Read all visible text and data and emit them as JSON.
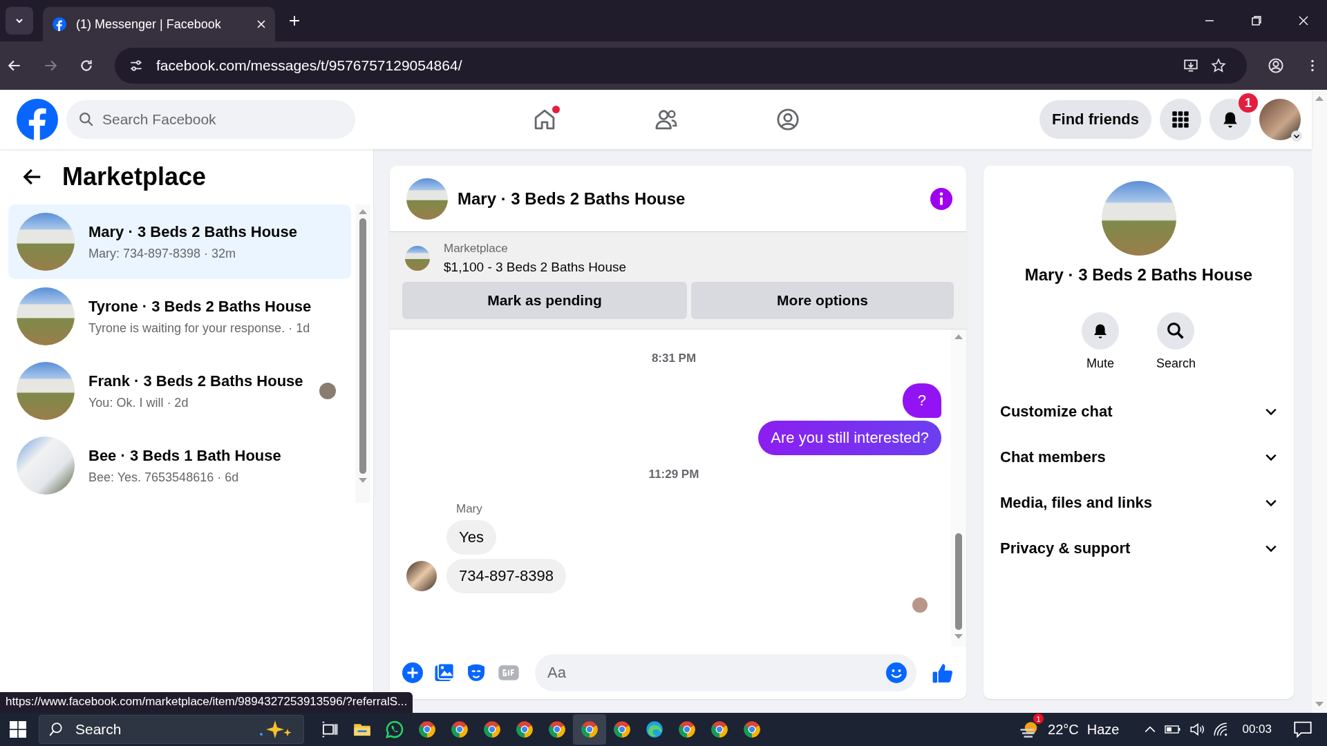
{
  "browser": {
    "tabs": [
      {
        "title": "(1) Messenger | Facebook",
        "selected": true
      }
    ],
    "url": "facebook.com/messages/t/9576757129054864/"
  },
  "fb_header": {
    "search_placeholder": "Search Facebook",
    "nav": [
      {
        "kind": "home",
        "dot": true
      },
      {
        "kind": "friends",
        "dot": false
      },
      {
        "kind": "groups",
        "dot": false
      }
    ],
    "find_friends": "Find friends",
    "notification_count": "1"
  },
  "sidebar": {
    "title": "Marketplace",
    "conversations": [
      {
        "title": "Mary · 3 Beds 2 Baths House",
        "preview": "Mary: 734-897-8398 · 32m",
        "selected": true,
        "seen": false,
        "kind": "house"
      },
      {
        "title": "Tyrone · 3 Beds 2 Baths House",
        "preview": "Tyrone is waiting for your response. · 1d",
        "selected": false,
        "seen": false,
        "kind": "house"
      },
      {
        "title": "Frank · 3 Beds 2 Baths House",
        "preview": "You: Ok. I will · 2d",
        "selected": false,
        "seen": true,
        "kind": "house"
      },
      {
        "title": "Bee · 3 Beds 1 Bath House",
        "preview": "Bee: Yes. 7653548616 · 6d",
        "selected": false,
        "seen": false,
        "kind": "white-house"
      }
    ]
  },
  "chat": {
    "title": "Mary · 3 Beds 2 Baths House",
    "listing": {
      "label": "Marketplace",
      "title": "$1,100 - 3 Beds 2 Baths House",
      "buttons": [
        "Mark as pending",
        "More options"
      ]
    },
    "messages": [
      {
        "kind": "time",
        "text": "8:31 PM"
      },
      {
        "kind": "outgoing",
        "text": "?"
      },
      {
        "kind": "outgoing",
        "text": "Are you still interested?"
      },
      {
        "kind": "time",
        "text": "11:29 PM"
      },
      {
        "kind": "sender",
        "text": "Mary"
      },
      {
        "kind": "incoming",
        "text": "Yes",
        "avatar": false
      },
      {
        "kind": "incoming",
        "text": "734-897-8398",
        "avatar": true
      }
    ],
    "seen": true,
    "composer_placeholder": "Aa"
  },
  "details": {
    "title": "Mary · 3 Beds 2 Baths House",
    "actions": [
      {
        "kind": "mute",
        "label": "Mute"
      },
      {
        "kind": "search",
        "label": "Search"
      }
    ],
    "sections": [
      {
        "label": "Customize chat",
        "expanded": false
      },
      {
        "label": "Chat members",
        "expanded": false
      },
      {
        "label": "Media, files and links",
        "expanded": false
      },
      {
        "label": "Privacy & support",
        "expanded": false
      }
    ]
  },
  "status_url": "https://www.facebook.com/marketplace/item/9894327253913596/?referralS...",
  "taskbar": {
    "search_placeholder": "Search",
    "apps": [
      {
        "kind": "files",
        "selected": false
      },
      {
        "kind": "whatsapp",
        "selected": false
      },
      {
        "kind": "chrome",
        "selected": false
      },
      {
        "kind": "chrome",
        "selected": false
      },
      {
        "kind": "chrome",
        "selected": false
      },
      {
        "kind": "chrome",
        "selected": false
      },
      {
        "kind": "chrome",
        "selected": false
      },
      {
        "kind": "chrome",
        "selected": true
      },
      {
        "kind": "chrome",
        "selected": false
      },
      {
        "kind": "edge",
        "selected": false
      },
      {
        "kind": "chrome",
        "selected": false
      },
      {
        "kind": "chrome",
        "selected": false
      },
      {
        "kind": "chrome",
        "selected": false
      }
    ],
    "weather_badge": "1",
    "temperature": "22°C",
    "condition": "Haze",
    "time": "00:03"
  }
}
